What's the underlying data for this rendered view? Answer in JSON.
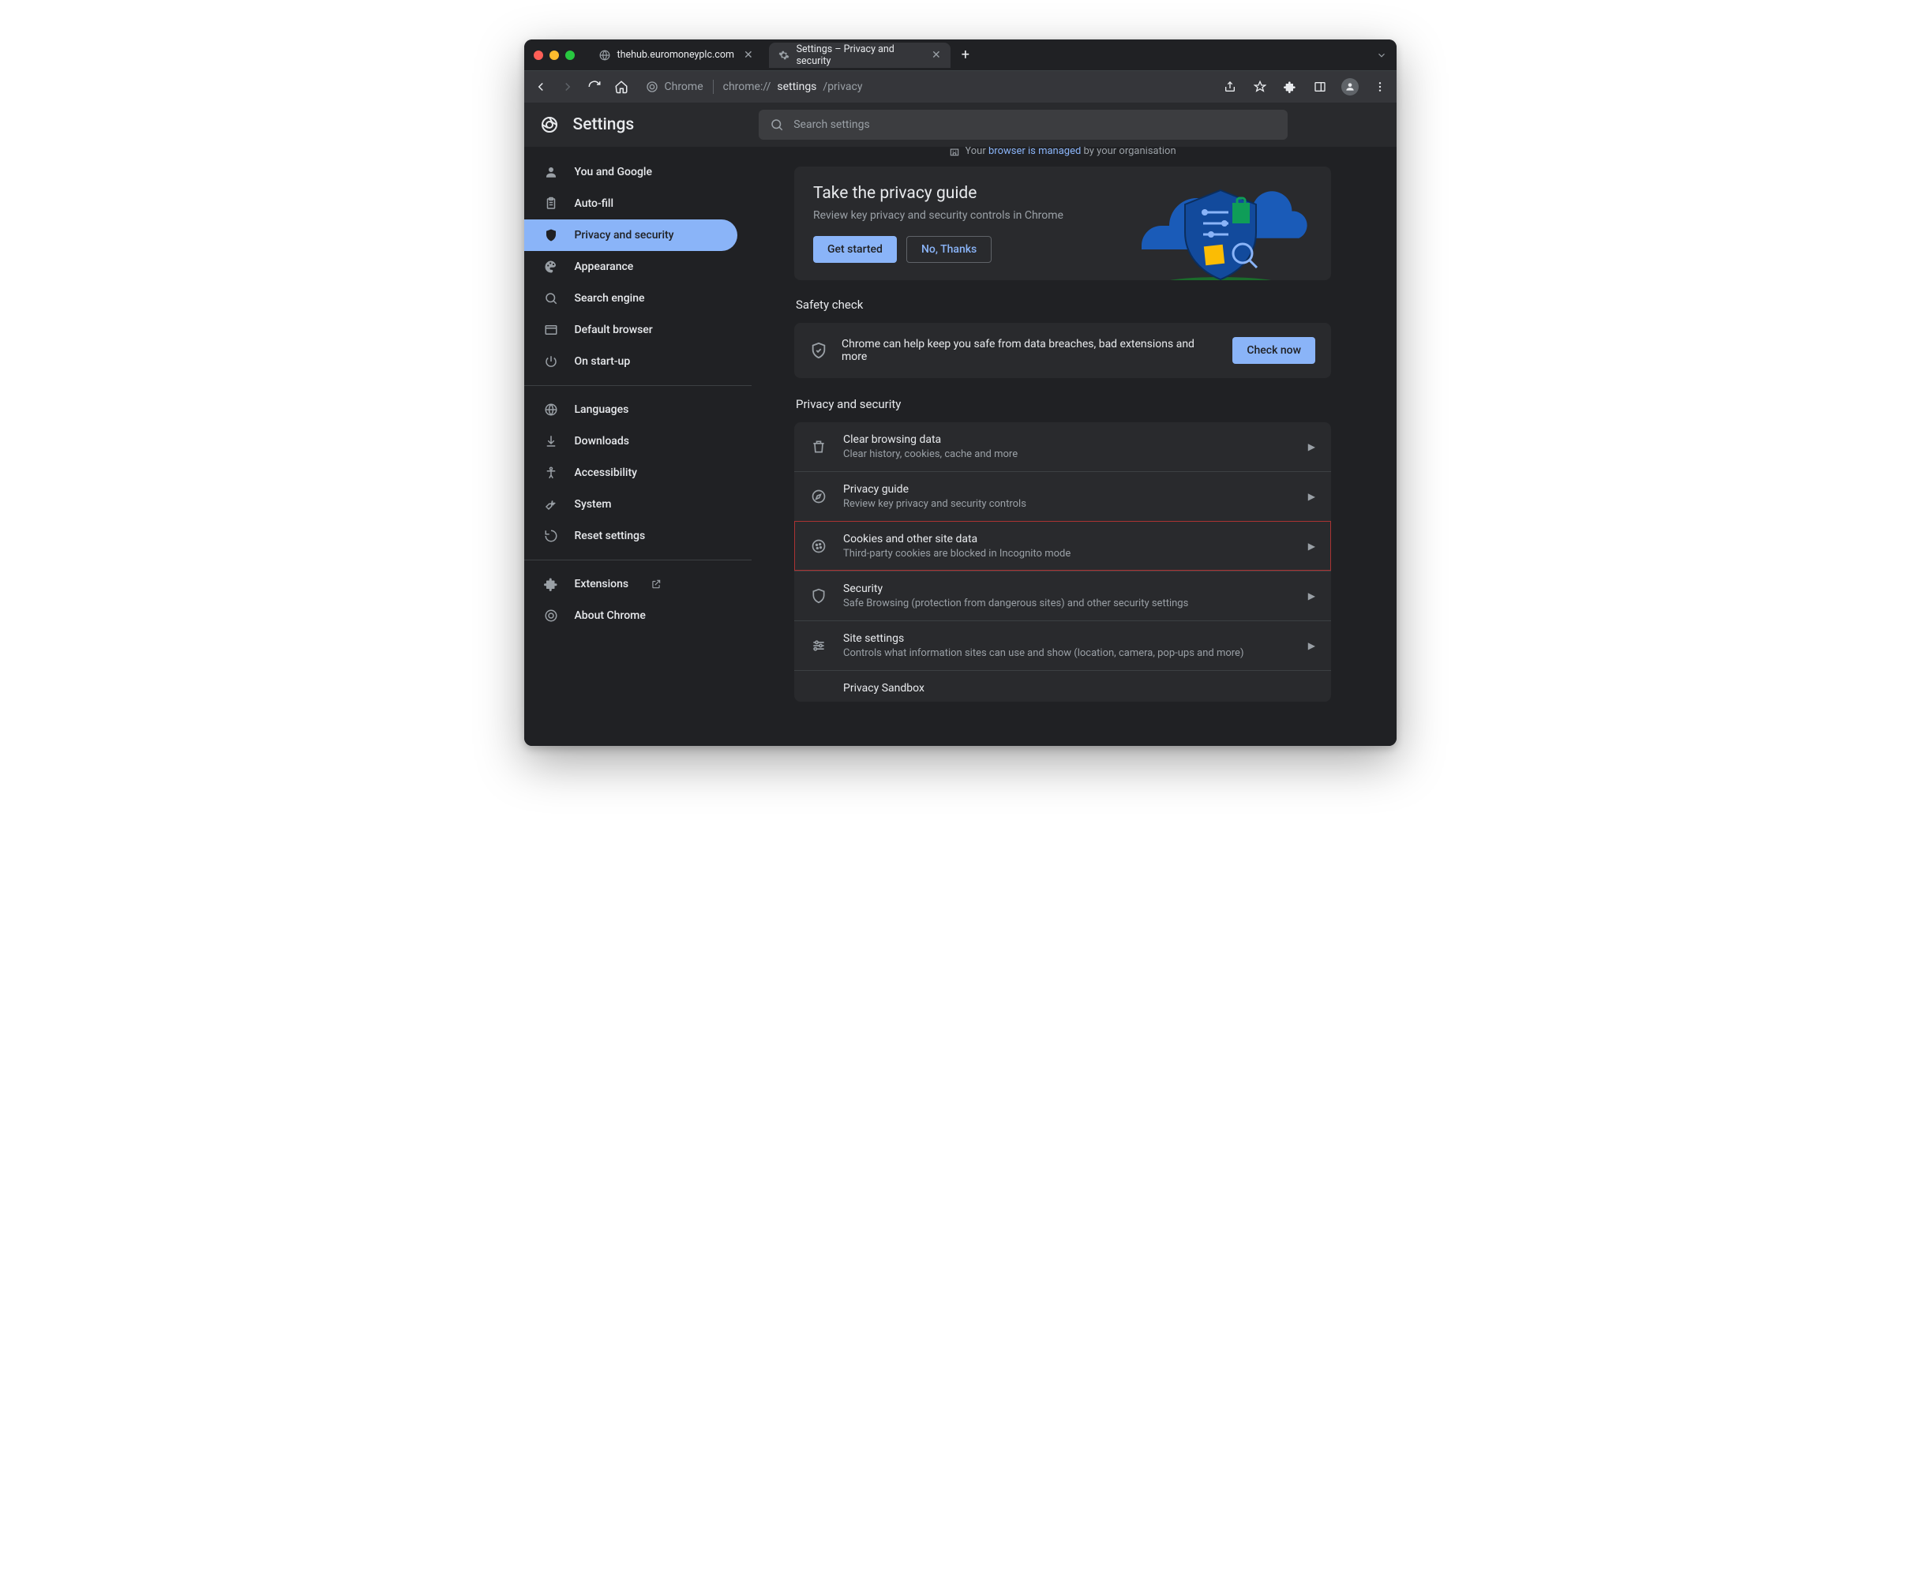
{
  "window": {
    "tabs": [
      {
        "title": "thehub.euromoneyplc.com",
        "active": false
      },
      {
        "title": "Settings – Privacy and security",
        "active": true
      }
    ]
  },
  "toolbar": {
    "url_prefix": "Chrome",
    "url_scheme": "chrome://",
    "url_path_bold": "settings",
    "url_path_rest": "/privacy"
  },
  "header": {
    "title": "Settings",
    "search_placeholder": "Search settings"
  },
  "sidebar": {
    "groups": [
      [
        {
          "label": "You and Google",
          "icon": "person"
        },
        {
          "label": "Auto-fill",
          "icon": "clipboard"
        },
        {
          "label": "Privacy and security",
          "icon": "shield",
          "active": true
        },
        {
          "label": "Appearance",
          "icon": "palette"
        },
        {
          "label": "Search engine",
          "icon": "search"
        },
        {
          "label": "Default browser",
          "icon": "browser"
        },
        {
          "label": "On start-up",
          "icon": "power"
        }
      ],
      [
        {
          "label": "Languages",
          "icon": "globe"
        },
        {
          "label": "Downloads",
          "icon": "download"
        },
        {
          "label": "Accessibility",
          "icon": "accessibility"
        },
        {
          "label": "System",
          "icon": "wrench"
        },
        {
          "label": "Reset settings",
          "icon": "restore"
        }
      ],
      [
        {
          "label": "Extensions",
          "icon": "extension",
          "external": true
        },
        {
          "label": "About Chrome",
          "icon": "chrome"
        }
      ]
    ]
  },
  "managed_banner": {
    "prefix": "Your ",
    "link": "browser is managed",
    "suffix": " by your organisation"
  },
  "guide_card": {
    "title": "Take the privacy guide",
    "subtitle": "Review key privacy and security controls in Chrome",
    "primary": "Get started",
    "secondary": "No, Thanks"
  },
  "safety": {
    "heading": "Safety check",
    "text": "Chrome can help keep you safe from data breaches, bad extensions and more",
    "button": "Check now"
  },
  "privacy_section": {
    "heading": "Privacy and security",
    "rows": [
      {
        "icon": "trash",
        "title": "Clear browsing data",
        "sub": "Clear history, cookies, cache and more"
      },
      {
        "icon": "compass",
        "title": "Privacy guide",
        "sub": "Review key privacy and security controls"
      },
      {
        "icon": "cookie",
        "title": "Cookies and other site data",
        "sub": "Third-party cookies are blocked in Incognito mode",
        "highlight": true
      },
      {
        "icon": "shield-outline",
        "title": "Security",
        "sub": "Safe Browsing (protection from dangerous sites) and other security settings"
      },
      {
        "icon": "tune",
        "title": "Site settings",
        "sub": "Controls what information sites can use and show (location, camera, pop-ups and more)"
      },
      {
        "icon": "sandbox",
        "title": "Privacy Sandbox",
        "sub": "",
        "partial": true
      }
    ]
  }
}
